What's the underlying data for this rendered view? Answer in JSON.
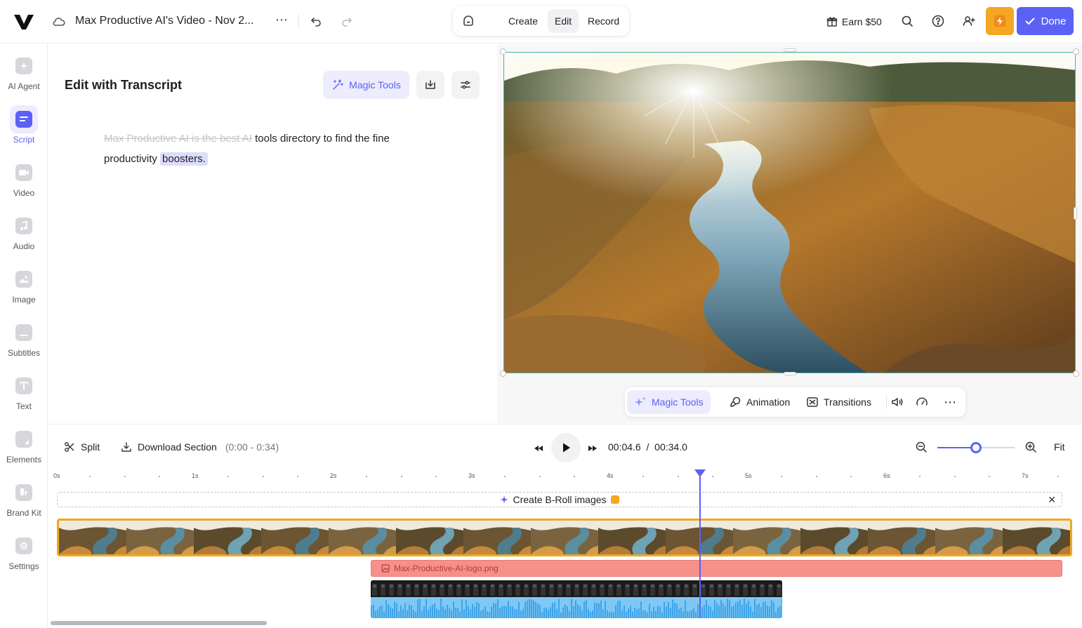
{
  "header": {
    "project_title": "Max Productive AI's Video - Nov 2...",
    "modes": [
      "Create",
      "Edit",
      "Record"
    ],
    "active_mode": "Edit",
    "earn_label": "Earn $50",
    "done_label": "Done"
  },
  "sidebar": {
    "items": [
      {
        "label": "AI Agent",
        "icon": "sparkle-icon"
      },
      {
        "label": "Script",
        "icon": "script-icon"
      },
      {
        "label": "Video",
        "icon": "video-camera-icon"
      },
      {
        "label": "Audio",
        "icon": "music-note-icon"
      },
      {
        "label": "Image",
        "icon": "image-icon"
      },
      {
        "label": "Subtitles",
        "icon": "subtitles-icon"
      },
      {
        "label": "Text",
        "icon": "text-icon"
      },
      {
        "label": "Elements",
        "icon": "elements-icon"
      },
      {
        "label": "Brand Kit",
        "icon": "brand-kit-icon"
      },
      {
        "label": "Settings",
        "icon": "settings-icon"
      }
    ],
    "active": "Script"
  },
  "transcript": {
    "title": "Edit with Transcript",
    "magic_tools_label": "Magic Tools",
    "struck_text": "Max Productive AI is the best AI",
    "text_part1": " tools directory to find the fine productivity ",
    "highlighted_text": "boosters."
  },
  "preview": {
    "toolbar": {
      "magic_tools_label": "Magic Tools",
      "animation_label": "Animation",
      "transitions_label": "Transitions"
    }
  },
  "timeline": {
    "split_label": "Split",
    "download_label": "Download Section",
    "download_range": "(0:00 - 0:34)",
    "current_time": "00:04.6",
    "time_separator": "/",
    "total_time": "00:34.0",
    "zoom_level": 0.5,
    "fit_label": "Fit",
    "ruler_labels": [
      "0s",
      "1s",
      "2s",
      "3s",
      "4s",
      "5s",
      "6s",
      "7s"
    ],
    "broll_label": "Create B-Roll images",
    "logo_clip_label": "Max-Productive-AI-logo.png"
  },
  "colors": {
    "accent": "#5b61f4",
    "warning": "#f5a623",
    "video_border": "#f0a81c",
    "logo_clip": "#f6908a",
    "audio_clip": "#7fc8f5"
  }
}
